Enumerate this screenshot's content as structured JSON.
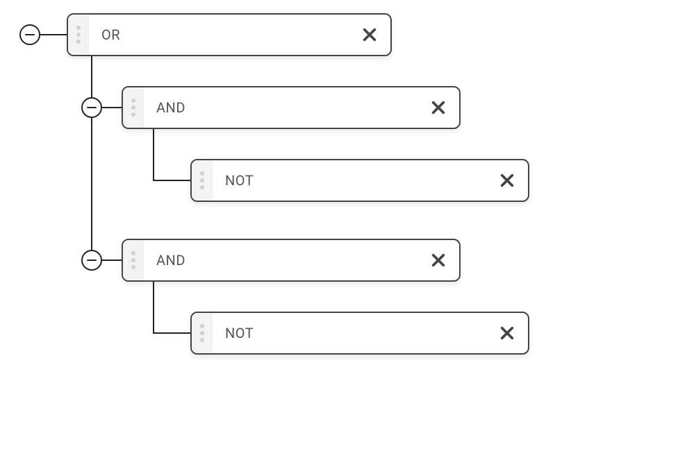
{
  "tree": {
    "root": {
      "operator": "OR"
    },
    "child1": {
      "operator": "AND"
    },
    "child1_1": {
      "operator": "NOT"
    },
    "child2": {
      "operator": "AND"
    },
    "child2_1": {
      "operator": "NOT"
    }
  },
  "layout": {
    "node_width_root": 468,
    "node_width_child": 488,
    "node_width_grandchild": 488
  }
}
